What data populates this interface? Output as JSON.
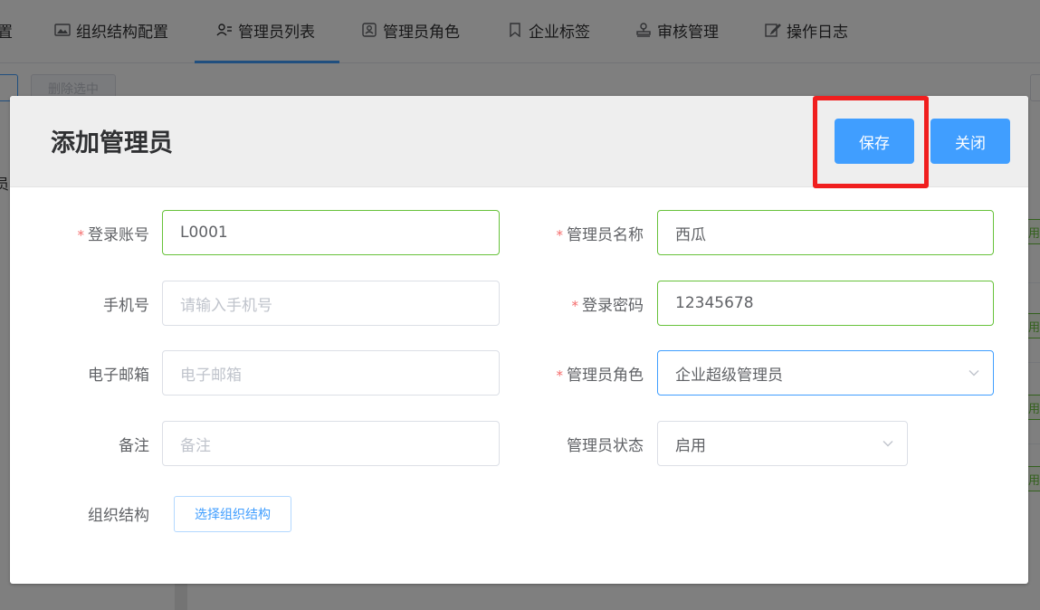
{
  "tabs": [
    {
      "label": "置",
      "icon": "settings-icon"
    },
    {
      "label": "组织结构配置",
      "icon": "image-icon"
    },
    {
      "label": "管理员列表",
      "icon": "user-list-icon"
    },
    {
      "label": "管理员角色",
      "icon": "id-card-icon"
    },
    {
      "label": "企业标签",
      "icon": "bookmark-icon"
    },
    {
      "label": "审核管理",
      "icon": "stamp-icon"
    },
    {
      "label": "操作日志",
      "icon": "edit-icon"
    }
  ],
  "background": {
    "delete_selected_label": "删除选中",
    "left_text": "员",
    "row_tag_text": "用"
  },
  "dialog": {
    "title": "添加管理员",
    "save_label": "保存",
    "close_label": "关闭"
  },
  "form": {
    "account": {
      "label": "登录账号",
      "required": true,
      "value": "L0001"
    },
    "name": {
      "label": "管理员名称",
      "required": true,
      "value": "西瓜"
    },
    "phone": {
      "label": "手机号",
      "required": false,
      "placeholder": "请输入手机号"
    },
    "password": {
      "label": "登录密码",
      "required": true,
      "value": "12345678"
    },
    "email": {
      "label": "电子邮箱",
      "required": false,
      "placeholder": "电子邮箱"
    },
    "role": {
      "label": "管理员角色",
      "required": true,
      "value": "企业超级管理员"
    },
    "remark": {
      "label": "备注",
      "required": false,
      "placeholder": "备注"
    },
    "status": {
      "label": "管理员状态",
      "required": false,
      "value": "启用"
    },
    "org": {
      "label": "组织结构",
      "button_label": "选择组织结构"
    }
  },
  "colors": {
    "primary": "#409eff",
    "success_border": "#67c23a",
    "required_star": "#f56c6c",
    "highlight": "#f01e1e"
  }
}
